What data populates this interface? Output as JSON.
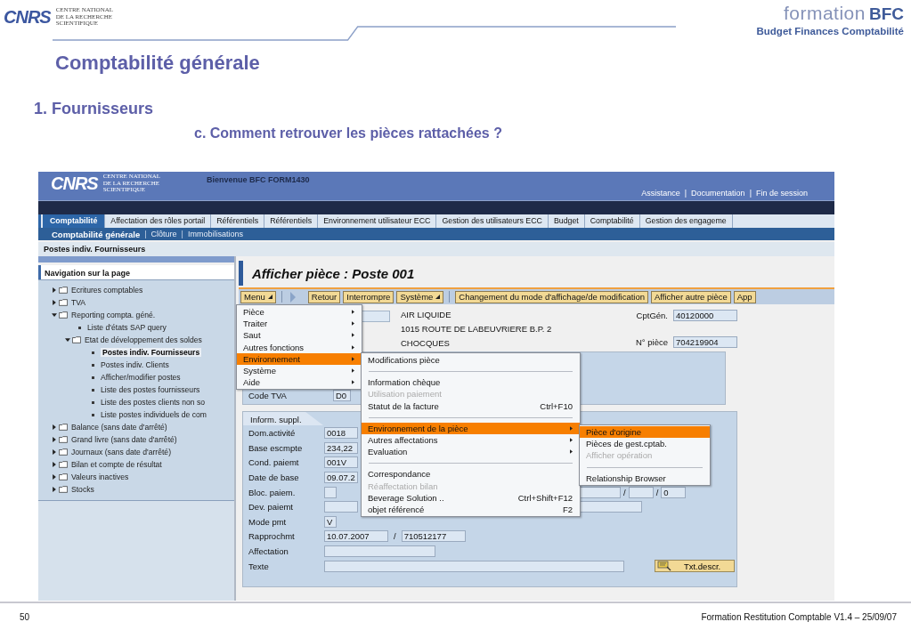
{
  "slide": {
    "logo": "CNRS",
    "logo_lines": [
      "CENTRE NATIONAL",
      "DE LA RECHERCHE",
      "SCIENTIFIQUE"
    ],
    "brand_word": "formation",
    "brand_acronym": "BFC",
    "brand_tagline": "Budget Finances Comptabilité",
    "title": "Comptabilité générale",
    "section": "1. Fournisseurs",
    "subsection": "c. Comment retrouver les pièces rattachées ?",
    "page_number": "50",
    "footer": "Formation Restitution Comptable V1.4 – 25/09/07"
  },
  "portal": {
    "logo": "CNRS",
    "logo_lines": [
      "CENTRE NATIONAL",
      "DE LA RECHERCHE",
      "SCIENTIFIQUE"
    ],
    "welcome": "Bienvenue BFC FORM1430",
    "links": [
      "Assistance",
      "Documentation",
      "Fin de session"
    ],
    "link_separator": "|"
  },
  "tabs": [
    {
      "label": "Comptabilité",
      "selected": true
    },
    {
      "label": "Affectation des rôles portail",
      "selected": false
    },
    {
      "label": "Référentiels",
      "selected": false
    },
    {
      "label": "Référentiels",
      "selected": false
    },
    {
      "label": "Environnement utilisateur ECC",
      "selected": false
    },
    {
      "label": "Gestion des utilisateurs ECC",
      "selected": false
    },
    {
      "label": "Budget",
      "selected": false
    },
    {
      "label": "Comptabilité",
      "selected": false
    },
    {
      "label": "Gestion des engageme",
      "selected": false
    }
  ],
  "subtabs": [
    {
      "label": "Comptabilité générale",
      "selected": true
    },
    {
      "label": "Clôture",
      "selected": false
    },
    {
      "label": "Immobilisations",
      "selected": false
    }
  ],
  "subtab_separator": "|",
  "breadcrumb": "Postes indiv. Fournisseurs",
  "navigation": {
    "title": "Navigation sur la page",
    "tree": [
      {
        "kind": "folder",
        "label": "Ecritures comptables",
        "expanded": false,
        "selected": false
      },
      {
        "kind": "folder",
        "label": "TVA",
        "expanded": false,
        "selected": false
      },
      {
        "kind": "folder",
        "label": "Reporting compta. géné.",
        "expanded": true,
        "selected": false,
        "children": [
          {
            "kind": "leaf",
            "label": "Liste d'états SAP query",
            "selected": false
          },
          {
            "kind": "folder",
            "label": "Etat de développement des soldes",
            "expanded": true,
            "selected": false,
            "children": [
              {
                "kind": "leaf",
                "label": "Postes indiv. Fournisseurs",
                "selected": true
              },
              {
                "kind": "leaf",
                "label": "Postes indiv. Clients",
                "selected": false
              },
              {
                "kind": "leaf",
                "label": "Afficher/modifier postes",
                "selected": false
              },
              {
                "kind": "leaf",
                "label": "Liste des postes fournisseurs",
                "selected": false
              },
              {
                "kind": "leaf",
                "label": "Liste des postes clients non so",
                "selected": false
              },
              {
                "kind": "leaf",
                "label": "Liste postes individuels de com",
                "selected": false
              }
            ]
          }
        ]
      },
      {
        "kind": "folder",
        "label": "Balance (sans date d'arrêté)",
        "expanded": false,
        "selected": false
      },
      {
        "kind": "folder",
        "label": "Grand livre (sans date d'arrêté)",
        "expanded": false,
        "selected": false
      },
      {
        "kind": "folder",
        "label": "Journaux (sans date d'arrêté)",
        "expanded": false,
        "selected": false
      },
      {
        "kind": "folder",
        "label": "Bilan et compte de résultat",
        "expanded": false,
        "selected": false
      },
      {
        "kind": "folder",
        "label": "Valeurs inactives",
        "expanded": false,
        "selected": false
      },
      {
        "kind": "folder",
        "label": "Stocks",
        "expanded": false,
        "selected": false
      }
    ]
  },
  "page_title": "Afficher pièce : Poste 001",
  "toolbar": [
    {
      "kind": "menu",
      "label": "Menu"
    },
    {
      "kind": "separator"
    },
    {
      "kind": "arrow"
    },
    {
      "kind": "button",
      "label": "Retour"
    },
    {
      "kind": "button",
      "label": "Interrompre"
    },
    {
      "kind": "menu",
      "label": "Système"
    },
    {
      "kind": "separator"
    },
    {
      "kind": "button",
      "label": "Changement du mode d'affichage/de modification"
    },
    {
      "kind": "button",
      "label": "Afficher autre pièce"
    },
    {
      "kind": "button",
      "label": "App"
    }
  ],
  "document": {
    "vendor_lines": [
      "AIR LIQUIDE",
      "1015 ROUTE DE LABEUVRIERE B.P. 2",
      "CHOCQUES"
    ],
    "fields": [
      {
        "label": "CptGén.",
        "value": "40120000"
      },
      {
        "label": "N° pièce",
        "value": "704219904"
      }
    ],
    "tax": {
      "label": "Code TVA",
      "value": "D0"
    }
  },
  "details": {
    "title": "Inform. suppl.",
    "rows": [
      {
        "kind": "field",
        "label": "Dom.activité",
        "value": "0018"
      },
      {
        "kind": "field",
        "label": "Base escmpte",
        "value": "234,22"
      },
      {
        "kind": "field",
        "label": "Cond. paiemt",
        "value": "001V"
      },
      {
        "kind": "field",
        "label": "Date de base",
        "value": "09.07.2"
      },
      {
        "kind": "checkbox",
        "label": "Bloc. paiem.",
        "checked": false,
        "right_separator": "/",
        "right_value": "0"
      },
      {
        "kind": "field",
        "label": "Dev. paiemt",
        "extra_field": true
      },
      {
        "kind": "short",
        "label": "Mode pmt",
        "value": "V"
      },
      {
        "kind": "pair",
        "label": "Rapprochmt",
        "value": "10.07.2007",
        "separator": "/",
        "value2": "710512177"
      },
      {
        "kind": "wide",
        "label": "Affectation"
      },
      {
        "kind": "text",
        "label": "Texte",
        "button": "Txt.descr."
      }
    ]
  },
  "menus": [
    {
      "items": [
        {
          "label": "Pièce",
          "submenu": true,
          "selected": false,
          "disabled": false
        },
        {
          "label": "Traiter",
          "submenu": true,
          "selected": false,
          "disabled": false
        },
        {
          "label": "Saut",
          "submenu": true,
          "selected": false,
          "disabled": false
        },
        {
          "label": "Autres fonctions",
          "submenu": true,
          "selected": false,
          "disabled": false
        },
        {
          "label": "Environnement",
          "submenu": true,
          "selected": true,
          "disabled": false
        },
        {
          "label": "Système",
          "submenu": true,
          "selected": false,
          "disabled": false
        },
        {
          "label": "Aide",
          "submenu": true,
          "selected": false,
          "disabled": false
        }
      ]
    },
    {
      "items": [
        {
          "label": "Modifications pièce",
          "selected": false,
          "disabled": false
        },
        {
          "kind": "separator"
        },
        {
          "label": "Information chèque",
          "selected": false,
          "disabled": false
        },
        {
          "label": "Utilisation paiement",
          "selected": false,
          "disabled": true
        },
        {
          "label": "Statut de la facture",
          "shortcut": "Ctrl+F10",
          "selected": false,
          "disabled": false
        },
        {
          "kind": "separator"
        },
        {
          "label": "Environnement de la pièce",
          "submenu": true,
          "selected": true,
          "disabled": false
        },
        {
          "label": "Autres affectations",
          "submenu": true,
          "selected": false,
          "disabled": false
        },
        {
          "label": "Evaluation",
          "submenu": true,
          "selected": false,
          "disabled": false
        },
        {
          "kind": "separator"
        },
        {
          "label": "Correspondance",
          "selected": false,
          "disabled": false
        },
        {
          "label": "Réaffectation bilan",
          "selected": false,
          "disabled": true
        },
        {
          "label": "Beverage Solution ..",
          "shortcut": "Ctrl+Shift+F12",
          "selected": false,
          "disabled": false
        },
        {
          "label": "objet référencé",
          "shortcut": "F2",
          "selected": false,
          "disabled": false
        }
      ]
    },
    {
      "items": [
        {
          "label": "Pièce d'origine",
          "selected": true,
          "disabled": false
        },
        {
          "label": "Pièces de gest.cptab.",
          "selected": false,
          "disabled": false
        },
        {
          "label": "Afficher opération",
          "selected": false,
          "disabled": true
        },
        {
          "kind": "separator"
        },
        {
          "label": "Relationship Browser",
          "selected": false,
          "disabled": false
        }
      ]
    }
  ]
}
